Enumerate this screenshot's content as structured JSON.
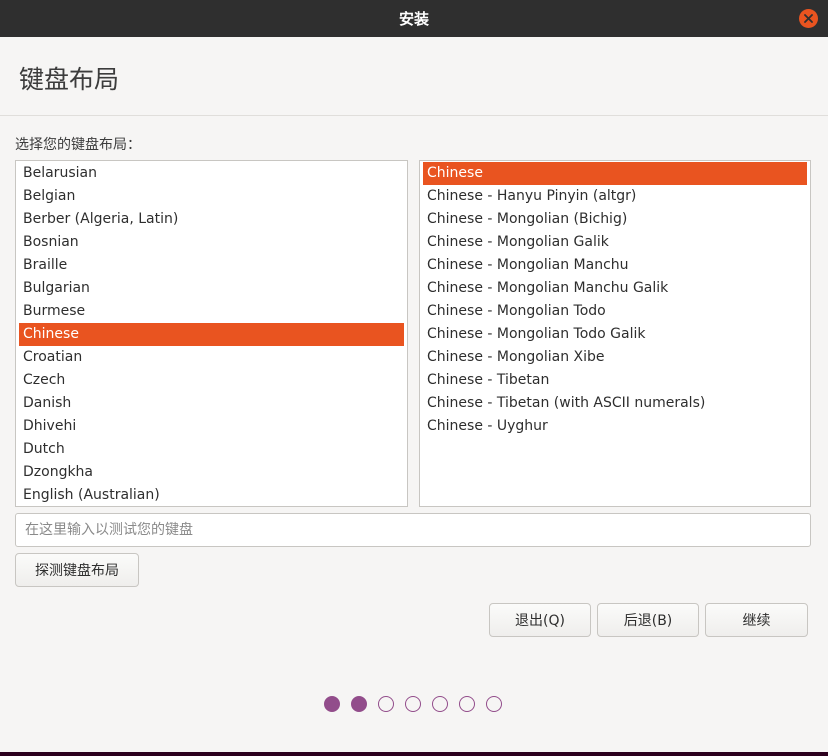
{
  "window": {
    "title": "安装",
    "close_icon": "close-icon"
  },
  "page": {
    "title": "键盘布局",
    "prompt": "选择您的键盘布局："
  },
  "layouts": {
    "items": [
      "Belarusian",
      "Belgian",
      "Berber (Algeria, Latin)",
      "Bosnian",
      "Braille",
      "Bulgarian",
      "Burmese",
      "Chinese",
      "Croatian",
      "Czech",
      "Danish",
      "Dhivehi",
      "Dutch",
      "Dzongkha",
      "English (Australian)"
    ],
    "selected": "Chinese"
  },
  "variants": {
    "items": [
      "Chinese",
      "Chinese - Hanyu Pinyin (altgr)",
      "Chinese - Mongolian (Bichig)",
      "Chinese - Mongolian Galik",
      "Chinese - Mongolian Manchu",
      "Chinese - Mongolian Manchu Galik",
      "Chinese - Mongolian Todo",
      "Chinese - Mongolian Todo Galik",
      "Chinese - Mongolian Xibe",
      "Chinese - Tibetan",
      "Chinese - Tibetan (with ASCII numerals)",
      "Chinese - Uyghur"
    ],
    "selected": "Chinese"
  },
  "test_input": {
    "placeholder": "在这里输入以测试您的键盘",
    "value": ""
  },
  "buttons": {
    "detect": "探测键盘布局",
    "quit": "退出(Q)",
    "back": "后退(B)",
    "continue": "继续"
  },
  "progress": {
    "total_steps": 7,
    "completed_steps": 2
  },
  "colors": {
    "accent": "#e95420",
    "titlebar": "#2f2f2f",
    "progress_dot": "#924d8b"
  }
}
